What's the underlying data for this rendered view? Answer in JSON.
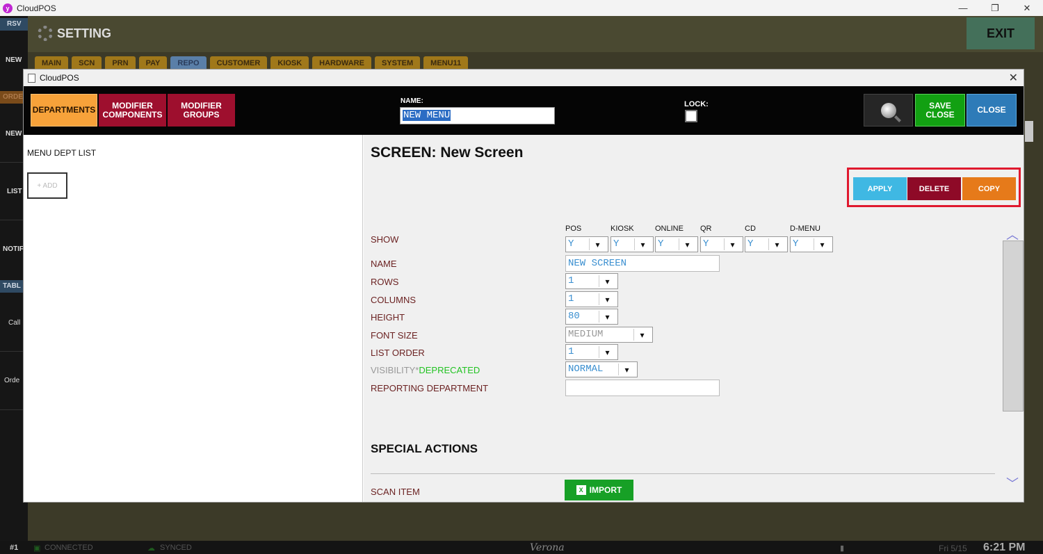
{
  "os": {
    "title": "CloudPOS",
    "minimize": "—",
    "maximize": "❐",
    "close": "✕"
  },
  "rail": [
    "RSV",
    "NEW",
    "ORDE",
    "NEW",
    "LIST",
    "NOTIF",
    "TABL",
    "Call",
    "Orde"
  ],
  "app": {
    "title": "SETTING",
    "exit": "EXIT",
    "tabs": [
      "MAIN",
      "SCN",
      "PRN",
      "PAY",
      "REPO",
      "CUSTOMER",
      "KIOSK",
      "HARDWARE",
      "SYSTEM",
      "MENU11"
    ]
  },
  "status": {
    "station": "#1",
    "connected": "CONNECTED",
    "synced": "SYNCED",
    "location": "Verona",
    "date": "Fri 5/15",
    "time": "6:21 PM"
  },
  "modal": {
    "title": "CloudPOS",
    "close": "✕",
    "toolbar": {
      "departments": "DEPARTMENTS",
      "modifier_components": "MODIFIER COMPONENTS",
      "modifier_groups": "MODIFIER GROUPS",
      "name_label": "NAME:",
      "name_value": "NEW MENU",
      "lock_label": "LOCK:",
      "save_close": "SAVE CLOSE",
      "close": "CLOSE"
    },
    "left": {
      "title": "MENU DEPT LIST",
      "add": "+ ADD"
    },
    "right": {
      "title": "SCREEN: New Screen",
      "apply": "APPLY",
      "delete": "DELETE",
      "copy": "COPY",
      "show": {
        "label": "SHOW",
        "columns": [
          "POS",
          "KIOSK",
          "ONLINE",
          "QR",
          "CD",
          "D-MENU"
        ],
        "values": [
          "Y",
          "Y",
          "Y",
          "Y",
          "Y",
          "Y"
        ]
      },
      "fields": {
        "name_label": "NAME",
        "name_value": "NEW SCREEN",
        "rows_label": "ROWS",
        "rows_value": "1",
        "columns_label": "COLUMNS",
        "columns_value": "1",
        "height_label": "HEIGHT",
        "height_value": "80",
        "font_size_label": "FONT SIZE",
        "font_size_value": "MEDIUM",
        "list_order_label": "LIST ORDER",
        "list_order_value": "1",
        "visibility_label": "VISIBILITY*",
        "visibility_deprecated": "DEPRECATED",
        "visibility_value": "NORMAL",
        "reporting_label": "REPORTING DEPARTMENT",
        "reporting_value": ""
      },
      "special_actions": "SPECIAL ACTIONS",
      "scan_item_label": "SCAN ITEM",
      "import": "IMPORT"
    }
  }
}
